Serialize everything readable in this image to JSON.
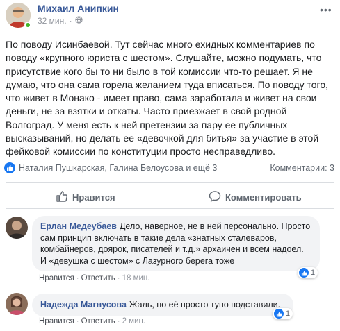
{
  "post": {
    "author": "Михаил Анипкин",
    "time": "32 мин.",
    "text": "По поводу Исинбаевой. Тут сейчас много ехидных комментариев по поводу «крупного юриста с шестом». Слушайте, можно подумать, что присутствие кого бы то ни было в той комиссии что-то решает. Я не думаю, что она сама горела желанием туда вписаться. По поводу того, что живет в Монако - имеет право, сама заработала и живет на свои деньги, не за взятки и откаты. Часто приезжает в свой родной Волгоград. У меня есть к ней претензии за пару ее публичных высказываний, но делать ее «девочкой для битья» за участие в этой фейковой комиссии по конституции просто несправедливо.",
    "reactions_text": "Наталия Пушкарская, Галина Белоусова и ещё 3",
    "comments_count": "Комментарии: 3"
  },
  "actions": {
    "like_label": "Нравится",
    "comment_label": "Комментировать"
  },
  "comments": [
    {
      "author": "Ерлан Медеубаев",
      "text": "Дело, наверное, не в ней персонально. Просто сам принцип включать в такие дела «знатных сталеваров, комбайнеров, доярок, писателей и т.д.» архаичен и всем надоел. И «девушка с шестом» с Лазурного берега тоже",
      "like": "Нравится",
      "reply": "Ответить",
      "time": "18 мин.",
      "likes": "1"
    },
    {
      "author": "Надежда Магнусова",
      "text": "Жаль, но её просто тупо подставили.",
      "like": "Нравится",
      "reply": "Ответить",
      "time": "2 мин.",
      "likes": "1"
    }
  ],
  "colors": {
    "name": "#385898",
    "like_blue": "#1877f2",
    "online": "#42b72a",
    "muted": "#606770"
  }
}
